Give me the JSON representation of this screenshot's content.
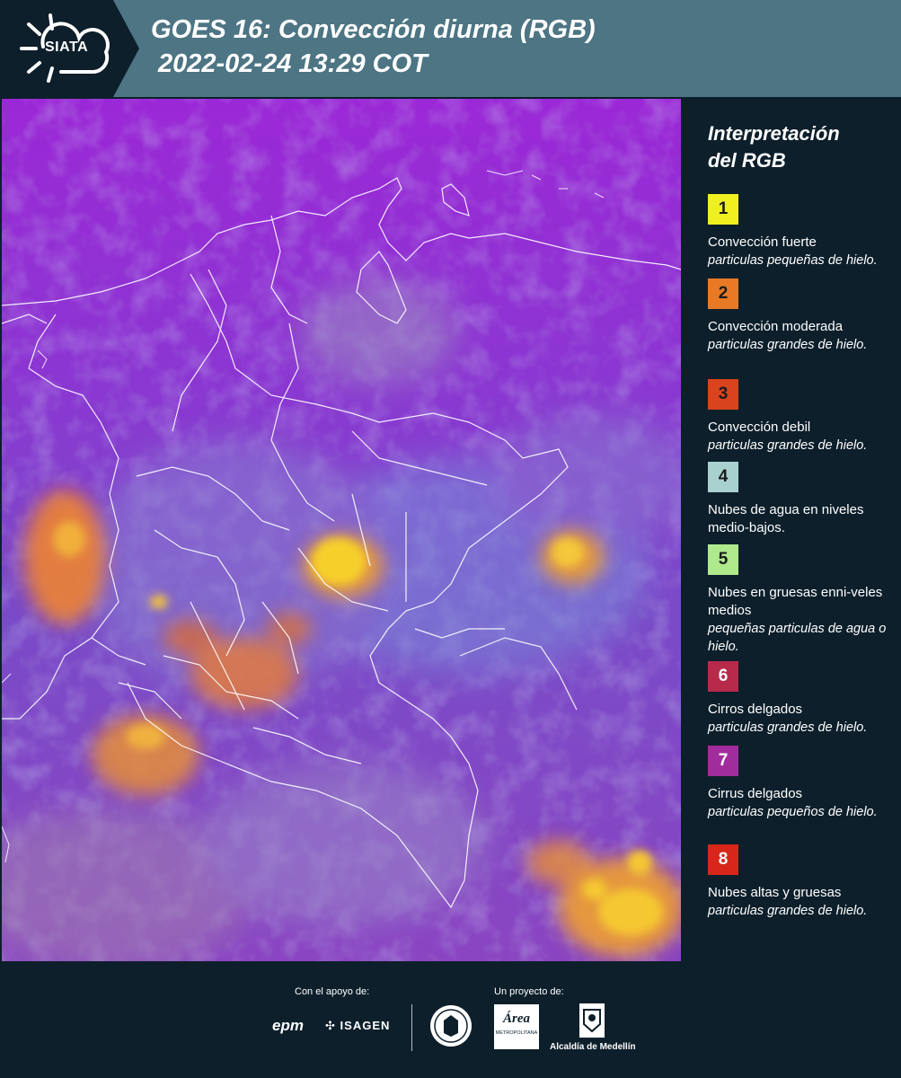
{
  "header": {
    "logo_text": "SIATA",
    "title_line1": "GOES 16: Convección diurna (RGB)",
    "title_line2": "2022-02-24 13:29 COT"
  },
  "legend": {
    "title_line1": "Interpretación",
    "title_line2": "del RGB",
    "items": [
      {
        "num": "1",
        "color": "#f0f020",
        "title": "Convección fuerte",
        "sub": "particulas pequeñas de hielo."
      },
      {
        "num": "2",
        "color": "#e87a25",
        "title": "Convección moderada",
        "sub": "particulas grandes de hielo."
      },
      {
        "num": "3",
        "color": "#d9431e",
        "title": "Convección debil",
        "sub": "particulas grandes de hielo."
      },
      {
        "num": "4",
        "color": "#a8d0cf",
        "title": "Nubes de agua en niveles medio-bajos.",
        "sub": ""
      },
      {
        "num": "5",
        "color": "#aee98c",
        "title": "Nubes en gruesas enni-veles medios",
        "sub": "pequeñas particulas de agua o hielo."
      },
      {
        "num": "6",
        "color": "#b82a4a",
        "title": "Cirros delgados",
        "sub": "particulas grandes de hielo."
      },
      {
        "num": "7",
        "color": "#a12d9c",
        "title": "Cirrus delgados",
        "sub": "particulas pequeños de hielo."
      },
      {
        "num": "8",
        "color": "#d8261a",
        "title": "Nubes altas y gruesas",
        "sub": "particulas grandes de hielo."
      }
    ]
  },
  "footer": {
    "support_label": "Con el apoyo de:",
    "project_label": "Un proyecto de:",
    "sponsor_epm": "epm",
    "sponsor_isagen": "ISAGEN",
    "area_text": "Área",
    "area_sub": "METROPOLITANA",
    "alcaldia": "Alcaldía de Medellín"
  }
}
